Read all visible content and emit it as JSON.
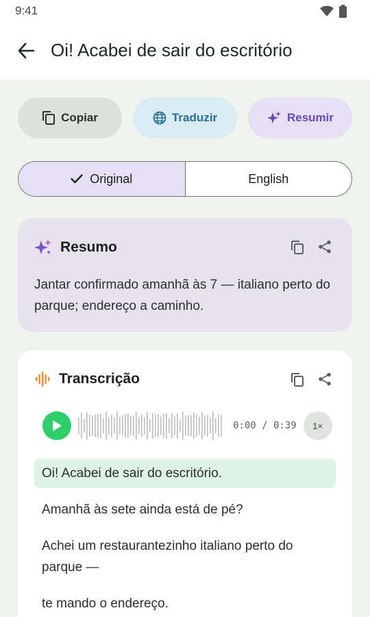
{
  "status": {
    "time": "9:41",
    "icons": [
      "wifi-icon",
      "battery-icon"
    ]
  },
  "appbar": {
    "back_icon": "arrow-left-icon",
    "title": "Oi! Acabei de sair do escritório"
  },
  "actions": {
    "copy_label": "Copiar",
    "translate_label": "Traduzir",
    "summarize_label": "Resumir"
  },
  "segment": {
    "original_label": "Original",
    "english_label": "English",
    "selected": "Original"
  },
  "summary": {
    "title": "Resumo",
    "text": "Jantar confirmado amanhã às 7 — italiano perto do parque; endereço a caminho."
  },
  "transcription": {
    "title": "Transcrição",
    "time_readout": "0:00 / 0:39",
    "speed_label": "1×",
    "lines": [
      "Oi! Acabei de sair do escritório.",
      "Amanhã às sete ainda está de pé?",
      "Achei um restaurantezinho italiano perto do parque —",
      "te mando o endereço."
    ]
  },
  "colors": {
    "accent_green": "#2ecf6a",
    "summary_bg": "#e6e3ef",
    "translate_blue": "#2a6f98",
    "summarize_purple": "#6a48b3",
    "audio_orange": "#f08a2a"
  }
}
